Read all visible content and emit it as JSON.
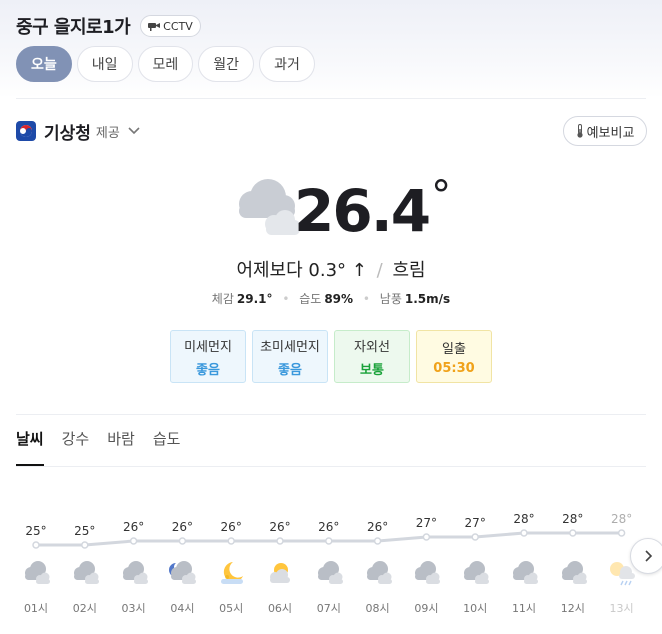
{
  "location": {
    "name": "중구 을지로1가",
    "cctv_label": "CCTV"
  },
  "day_tabs": [
    {
      "label": "오늘",
      "active": true
    },
    {
      "label": "내일",
      "active": false
    },
    {
      "label": "모레",
      "active": false
    },
    {
      "label": "월간",
      "active": false
    },
    {
      "label": "과거",
      "active": false
    }
  ],
  "provider": {
    "name": "기상청",
    "suffix": "제공",
    "compare_label": "예보비교"
  },
  "current": {
    "temp": "26.4",
    "degree": "°",
    "icon": "cloudy-icon",
    "compare_text": "어제보다",
    "compare_value": "0.3°",
    "compare_arrow": "↑",
    "separator": "/",
    "condition": "흐림",
    "feels_label": "체감",
    "feels_value": "29.1°",
    "humidity_label": "습도",
    "humidity_value": "89%",
    "wind_label": "남풍",
    "wind_value": "1.5m/s"
  },
  "chips": [
    {
      "label": "미세먼지",
      "value": "좋음",
      "tone": "blue"
    },
    {
      "label": "초미세먼지",
      "value": "좋음",
      "tone": "blue"
    },
    {
      "label": "자외선",
      "value": "보통",
      "tone": "green"
    },
    {
      "label": "일출",
      "value": "05:30",
      "tone": "yellow"
    }
  ],
  "sub_tabs": [
    {
      "label": "날씨",
      "active": true
    },
    {
      "label": "강수",
      "active": false
    },
    {
      "label": "바람",
      "active": false
    },
    {
      "label": "습도",
      "active": false
    }
  ],
  "hourly": [
    {
      "time": "01시",
      "temp": "25°",
      "value": 25,
      "icon": "cloudy-icon"
    },
    {
      "time": "02시",
      "temp": "25°",
      "value": 25,
      "icon": "cloudy-icon"
    },
    {
      "time": "03시",
      "temp": "26°",
      "value": 26,
      "icon": "cloudy-icon"
    },
    {
      "time": "04시",
      "temp": "26°",
      "value": 26,
      "icon": "cloudy-night-icon"
    },
    {
      "time": "05시",
      "temp": "26°",
      "value": 26,
      "icon": "moon-icon"
    },
    {
      "time": "06시",
      "temp": "26°",
      "value": 26,
      "icon": "partly-sunny-icon"
    },
    {
      "time": "07시",
      "temp": "26°",
      "value": 26,
      "icon": "cloudy-icon"
    },
    {
      "time": "08시",
      "temp": "26°",
      "value": 26,
      "icon": "cloudy-icon"
    },
    {
      "time": "09시",
      "temp": "27°",
      "value": 27,
      "icon": "cloudy-icon"
    },
    {
      "time": "10시",
      "temp": "27°",
      "value": 27,
      "icon": "cloudy-icon"
    },
    {
      "time": "11시",
      "temp": "28°",
      "value": 28,
      "icon": "cloudy-icon"
    },
    {
      "time": "12시",
      "temp": "28°",
      "value": 28,
      "icon": "cloudy-icon"
    },
    {
      "time": "13시",
      "temp": "28°",
      "value": 28,
      "icon": "sun-rain-icon"
    }
  ],
  "colors": {
    "active_tab": "#8192b5",
    "temp_line": "#d3d7de",
    "good": "#3a98dc",
    "normal": "#1aa23a",
    "sunrise": "#f0a21a"
  }
}
